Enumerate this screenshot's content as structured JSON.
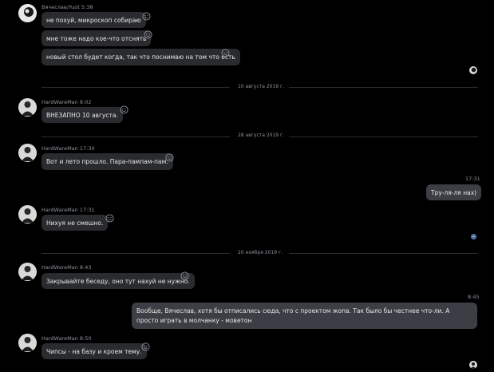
{
  "messages": [
    {
      "author": "Вячеслав/Yuot",
      "time": "5:38",
      "lines": [
        "не похуй, микроскоп собираю",
        "мне тоже надо кое-что отснять",
        "новый стол будет когда, так что поснимаю на том что есть"
      ]
    },
    {
      "author": "HardWareMan",
      "time": "8:02",
      "lines": [
        "ВНЕЗАПНО 10 августа."
      ]
    },
    {
      "author": "HardWareMan",
      "time": "17:30",
      "lines": [
        "Вот и лето прошло. Пара-пампам-пам."
      ]
    },
    {
      "author": "HardWareMan",
      "time": "17:31",
      "lines": [
        "Нихуя не смешно."
      ]
    },
    {
      "author": "HardWareMan",
      "time": "8:43",
      "lines": [
        "Закрывайте беседу, оно тут нахуй не нужно."
      ]
    },
    {
      "author": "HardWareMan",
      "time": "8:50",
      "lines": [
        "Чипсы - на базу и кроем тему."
      ]
    }
  ],
  "own_messages": [
    {
      "time": "17:31",
      "text": "Тру-ля-ля нах)"
    },
    {
      "time": "8:45",
      "text": "Вообще, Вячеслав, хотя бы отписались сюда, что с проектом жопа. Так было бы честнее что-ли. А просто играть в молчанку - моветон"
    }
  ],
  "dates": [
    "10 августа 2019 г.",
    "28 августа 2019 г.",
    "20 ноября 2019 г."
  ],
  "icons": {
    "reaction": "smile-icon",
    "read": "read-receipt-icon"
  },
  "colors": {
    "background": "#000000",
    "bubble": "#2a2b2f",
    "own_bubble": "#3b3f45",
    "meta": "#8d939b",
    "text": "#e6e6e6",
    "unread": "#4a6fa5"
  }
}
